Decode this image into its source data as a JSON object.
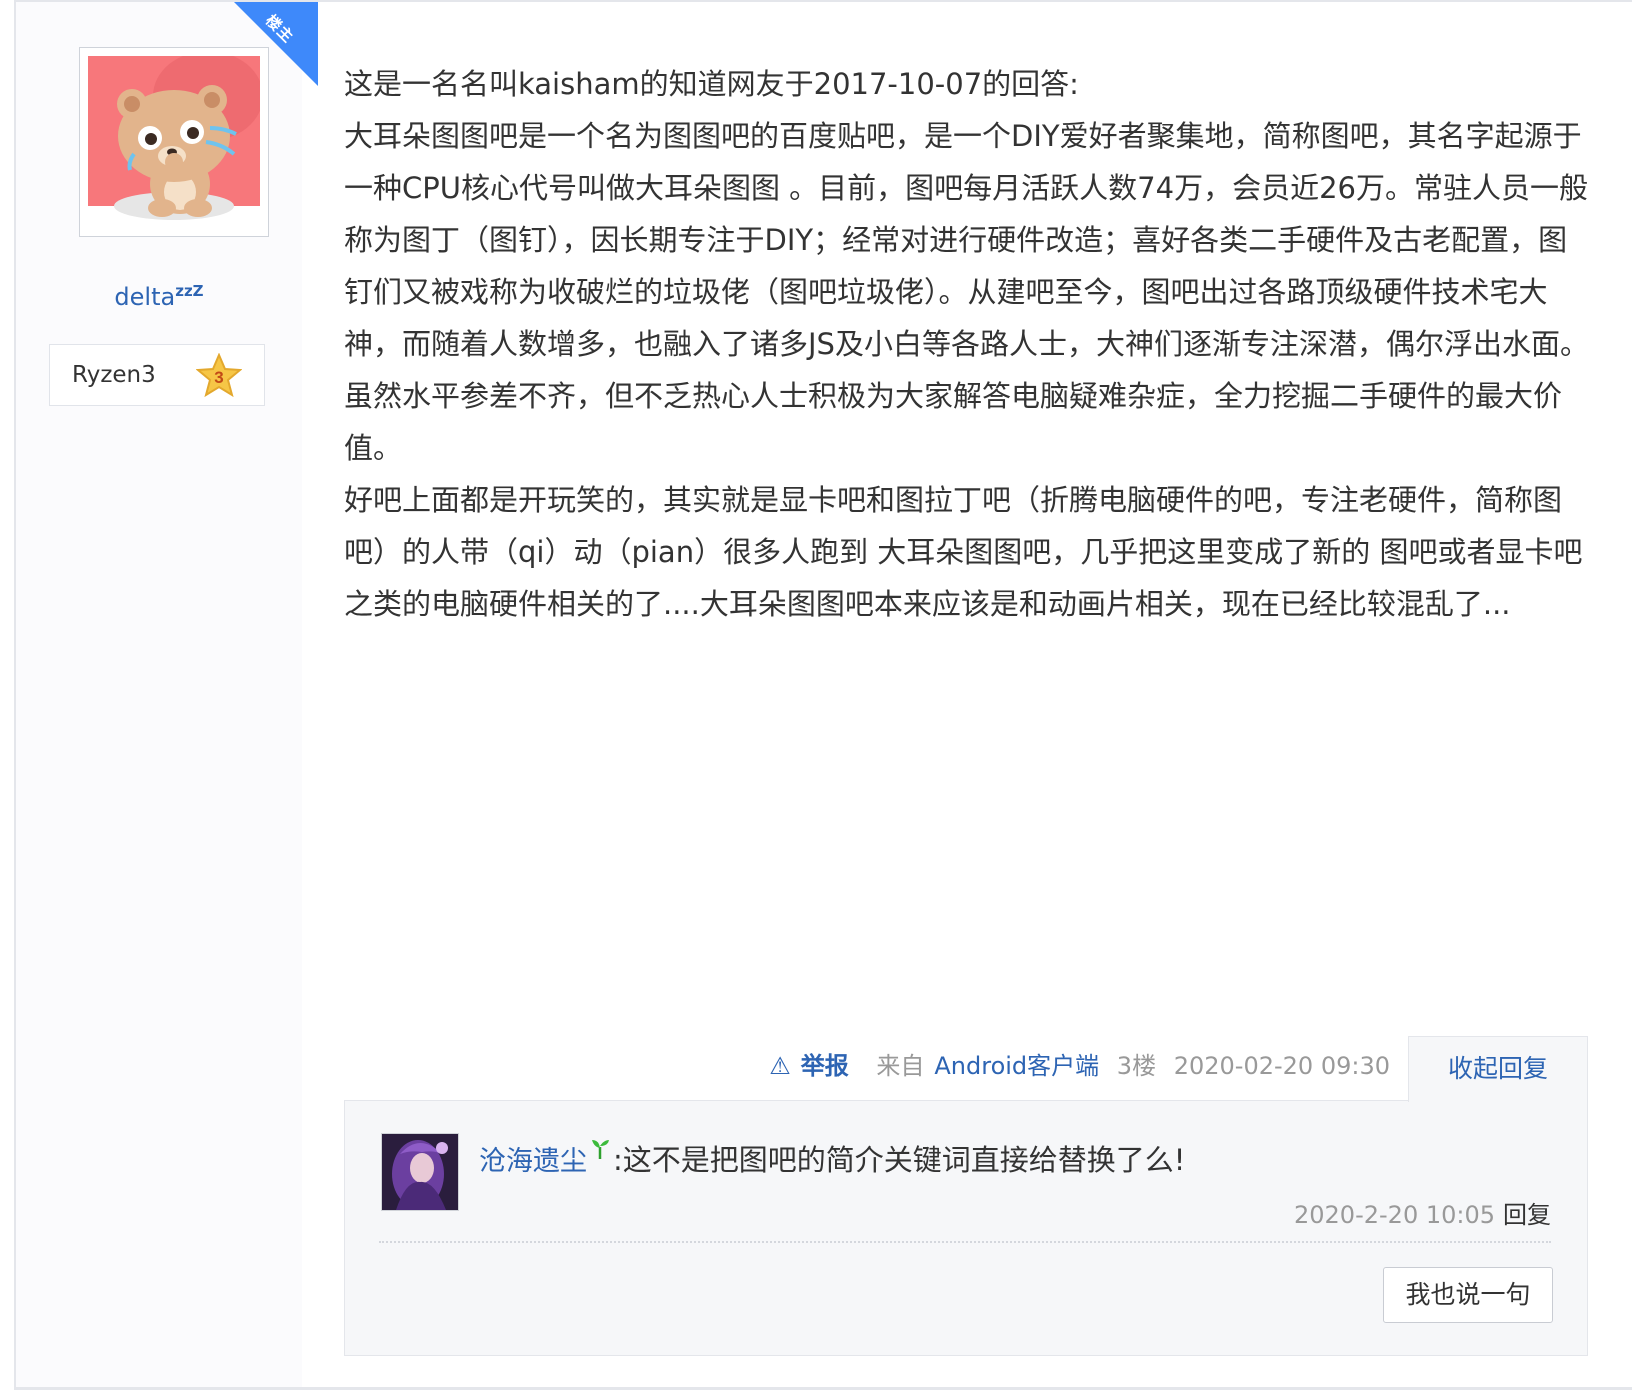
{
  "author": {
    "badge": "楼主",
    "username": "delta",
    "username_suffix": "zzZ",
    "level_name": "Ryzen3",
    "level_number": "3"
  },
  "post": {
    "paragraphs": [
      "这是一名名叫kaisham的知道网友于2017-10-07的回答:",
      "大耳朵图图吧是一个名为图图吧的百度贴吧，是一个DIY爱好者聚集地，简称图吧，其名字起源于一种CPU核心代号叫做大耳朵图图 。目前，图吧每月活跃人数74万，会员近26万。常驻人员一般称为图丁（图钉），因长期专注于DIY；经常对进行硬件改造；喜好各类二手硬件及古老配置，图钉们又被戏称为收破烂的垃圾佬（图吧垃圾佬）。从建吧至今，图吧出过各路顶级硬件技术宅大神，而随着人数增多，也融入了诸多JS及小白等各路人士，大神们逐渐专注深潜，偶尔浮出水面。虽然水平参差不齐，但不乏热心人士积极为大家解答电脑疑难杂症，全力挖掘二手硬件的最大价值。",
      "好吧上面都是开玩笑的，其实就是显卡吧和图拉丁吧（折腾电脑硬件的吧，专注老硬件，简称图吧）的人带（qi）动（pian）很多人跑到 大耳朵图图吧，几乎把这里变成了新的 图吧或者显卡吧之类的电脑硬件相关的了....大耳朵图图吧本来应该是和动画片相关，现在已经比较混乱了..."
    ],
    "meta": {
      "report_icon": "⚠",
      "report_label": "举报",
      "client_prefix": "来自",
      "client_name": "Android客户端",
      "floor": "3楼",
      "time": "2020-02-20 09:30"
    },
    "collapse_label": "收起回复"
  },
  "replies": [
    {
      "username": "沧海遗尘",
      "text": ":这不是把图吧的简介关键词直接给替换了么!",
      "time": "2020-2-20 10:05",
      "reply_label": "回复"
    }
  ],
  "say_button_label": "我也说一句",
  "colors": {
    "link": "#2d64b3",
    "ribbon": "#3e89fa",
    "muted": "#999999",
    "panel_bg": "#f6f7f9"
  }
}
